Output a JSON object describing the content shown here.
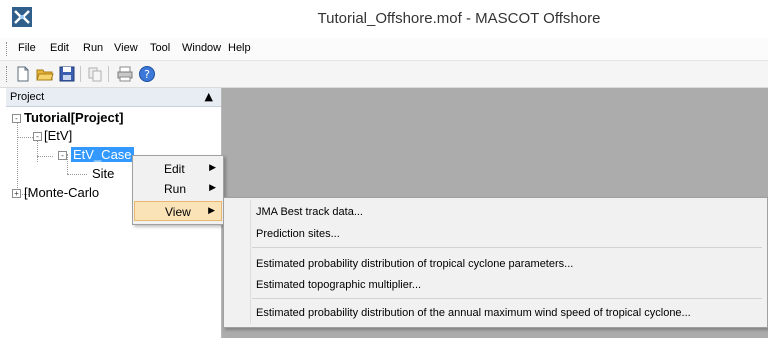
{
  "window": {
    "title": "Tutorial_Offshore.mof - MASCOT Offshore",
    "icon": "app-logo-icon"
  },
  "menu": {
    "items": [
      "File",
      "Edit",
      "Run",
      "View",
      "Tool",
      "Window",
      "Help"
    ]
  },
  "toolbar": {
    "buttons": [
      "new-file-icon",
      "open-folder-icon",
      "save-icon",
      "copy-icon",
      "print-icon",
      "help-icon"
    ]
  },
  "project_panel": {
    "title": "Project",
    "pin_icon": "pin-icon",
    "tree": {
      "root": "Tutorial[Project]",
      "etv": "[EtV]",
      "etv_case": "EtV_Case",
      "site": "Site",
      "monte_carlo": "[Monte-Carlo"
    },
    "selection_color": "#3399ff"
  },
  "context_menu": {
    "items": [
      {
        "label": "Edit",
        "has_submenu": true
      },
      {
        "label": "Run",
        "has_submenu": true
      },
      {
        "label": "View",
        "has_submenu": true,
        "highlighted": true
      }
    ],
    "highlight_color": "#fbe3b8"
  },
  "view_submenu": {
    "items": [
      "JMA Best track data...",
      "Prediction sites...",
      "Estimated probability distribution of tropical cyclone parameters...",
      "Estimated topographic multiplier...",
      "Estimated probability distribution of the annual maximum wind speed of tropical cyclone..."
    ]
  },
  "colors": {
    "workspace": "#acacac"
  }
}
